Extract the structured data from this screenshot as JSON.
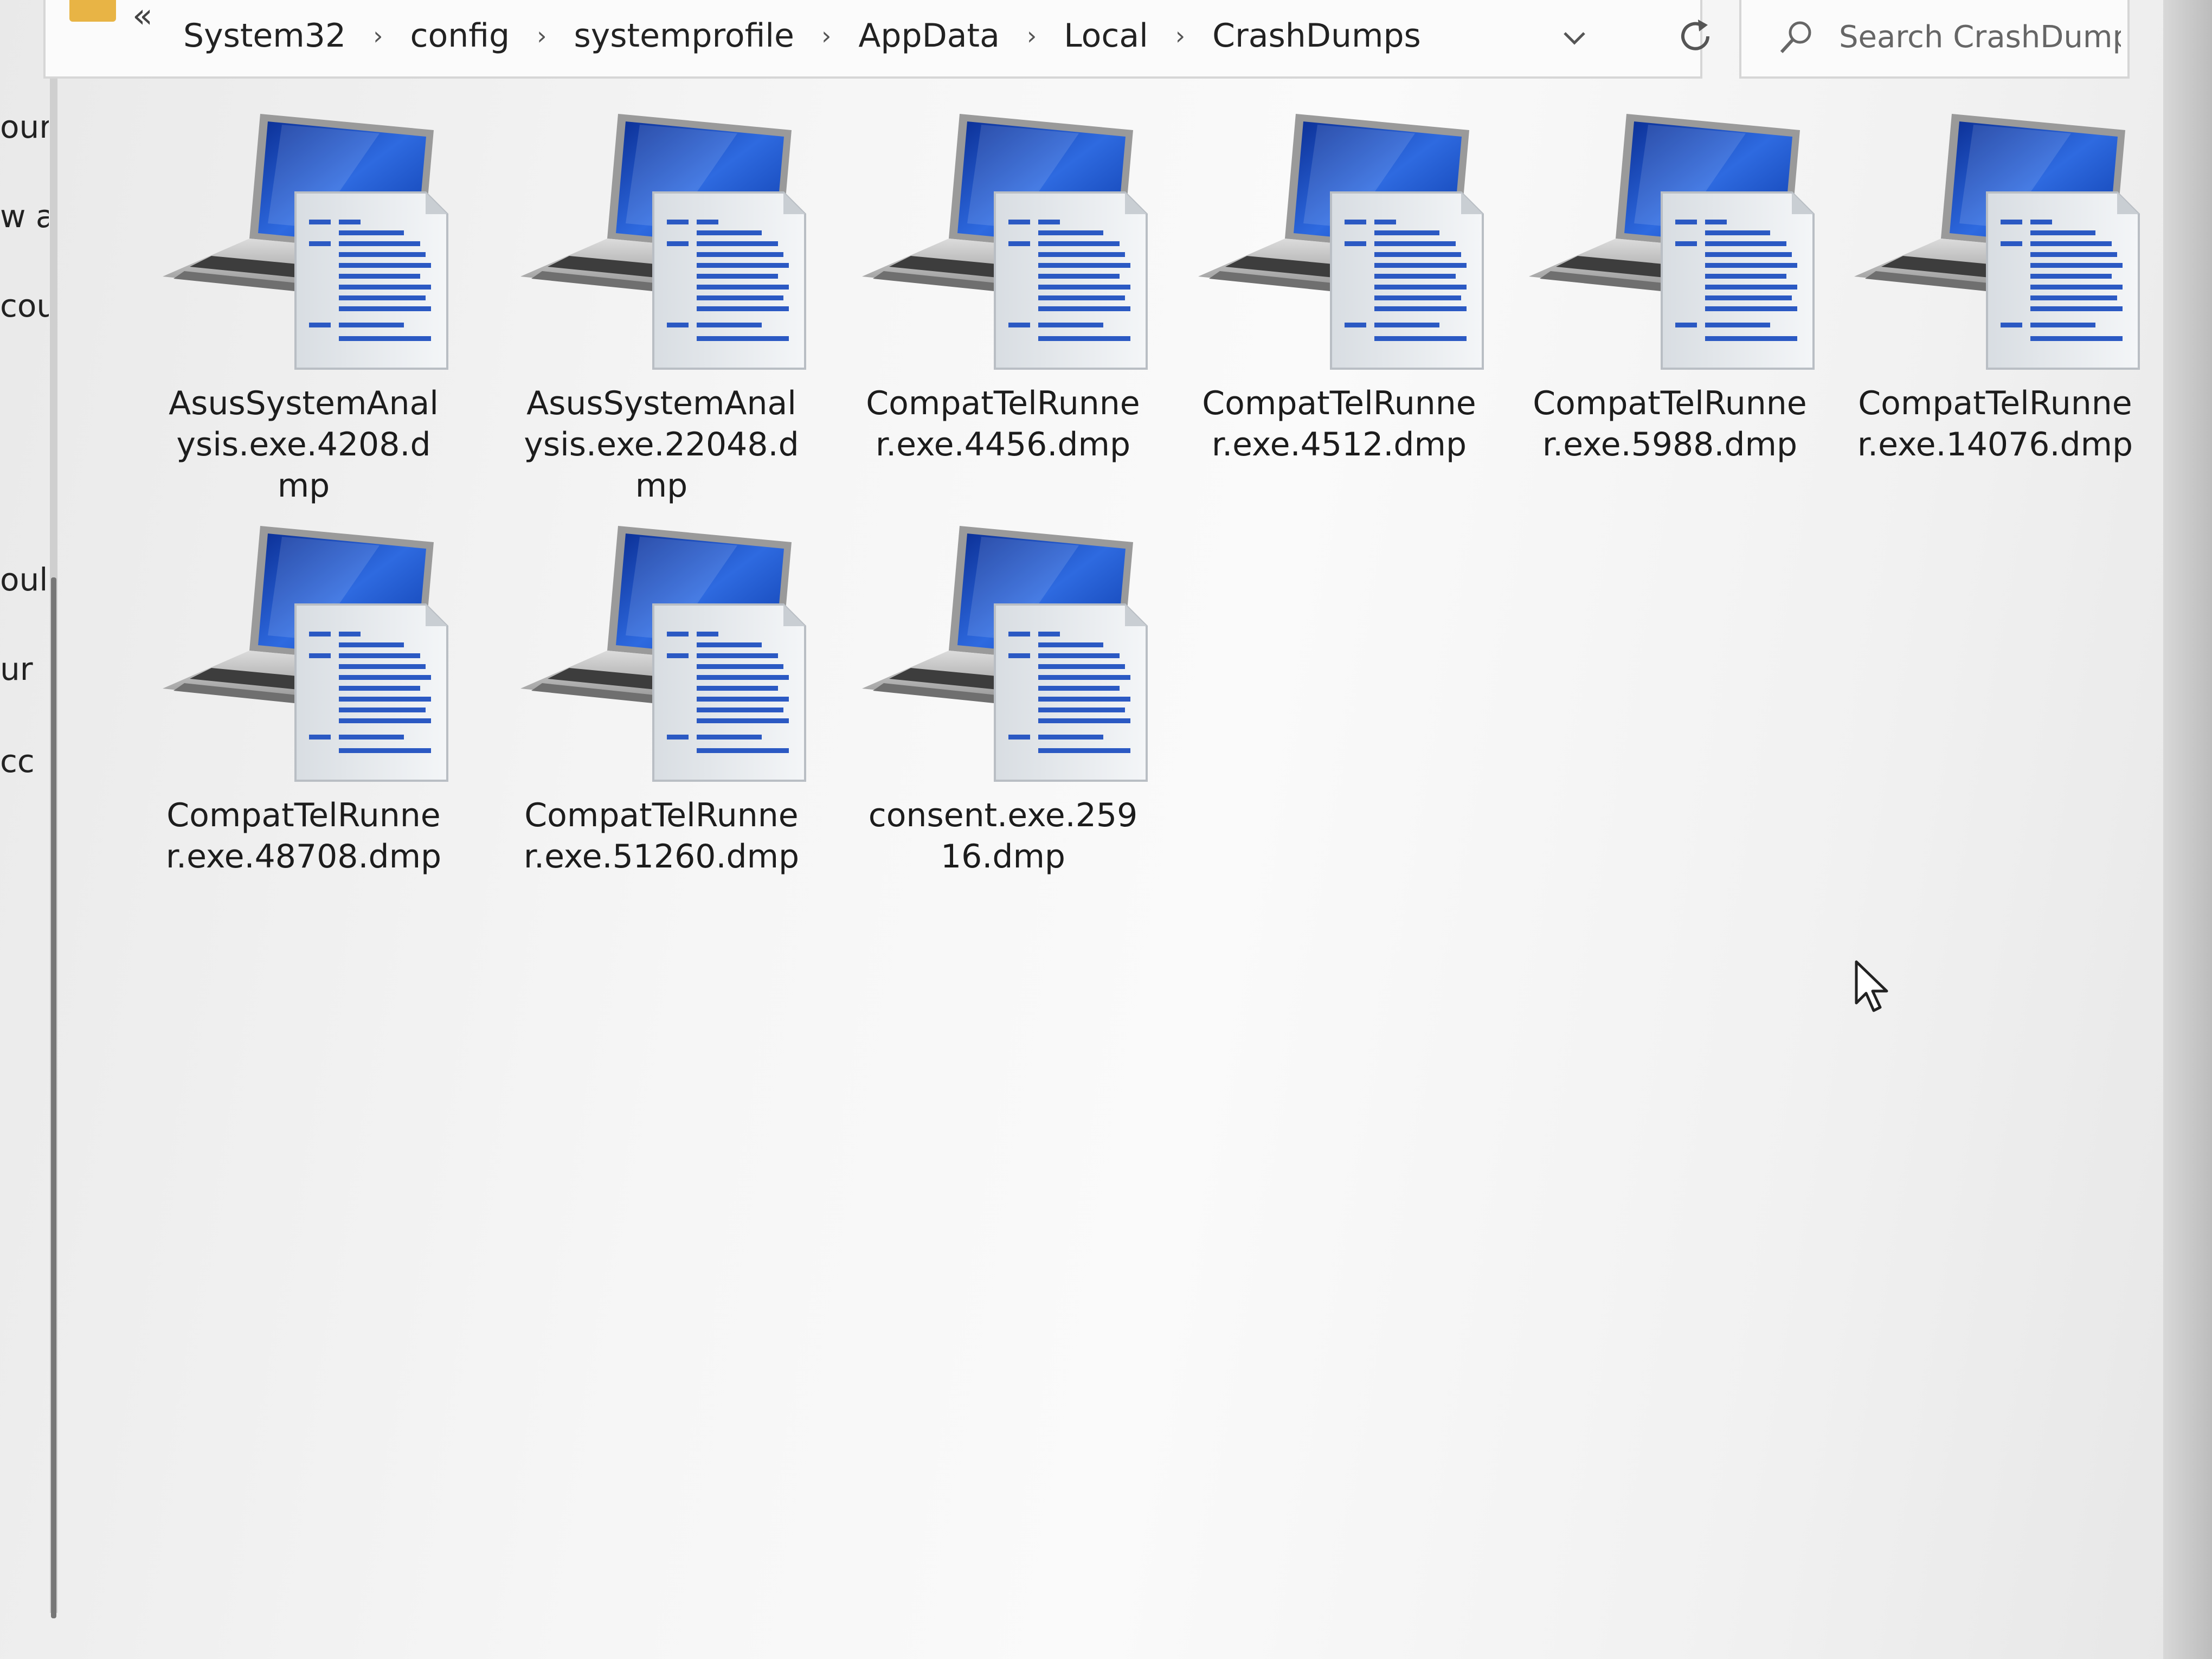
{
  "address_bar": {
    "overflow_label": "«",
    "breadcrumbs": [
      "System32",
      "config",
      "systemprofile",
      "AppData",
      "Local",
      "CrashDumps"
    ],
    "separator": "›"
  },
  "search": {
    "placeholder": "Search CrashDumps"
  },
  "nav_pane": {
    "items": [
      "our",
      "w a",
      "cou",
      "oul",
      "ur",
      "cc"
    ]
  },
  "files": [
    {
      "name": "AsusSystemAnalysis.exe.4208.dmp",
      "icon": "crash-dump-file-icon"
    },
    {
      "name": "AsusSystemAnalysis.exe.22048.dmp",
      "icon": "crash-dump-file-icon"
    },
    {
      "name": "CompatTelRunner.exe.4456.dmp",
      "icon": "crash-dump-file-icon"
    },
    {
      "name": "CompatTelRunner.exe.4512.dmp",
      "icon": "crash-dump-file-icon"
    },
    {
      "name": "CompatTelRunner.exe.5988.dmp",
      "icon": "crash-dump-file-icon"
    },
    {
      "name": "CompatTelRunner.exe.14076.dmp",
      "icon": "crash-dump-file-icon"
    },
    {
      "name": "CompatTelRunner.exe.48708.dmp",
      "icon": "crash-dump-file-icon"
    },
    {
      "name": "CompatTelRunner.exe.51260.dmp",
      "icon": "crash-dump-file-icon"
    },
    {
      "name": "consent.exe.25916.dmp",
      "icon": "crash-dump-file-icon"
    }
  ],
  "colors": {
    "folder": "#e8b445",
    "screen_blue": "#1f4fb8",
    "doc_lines": "#2b59c3"
  }
}
